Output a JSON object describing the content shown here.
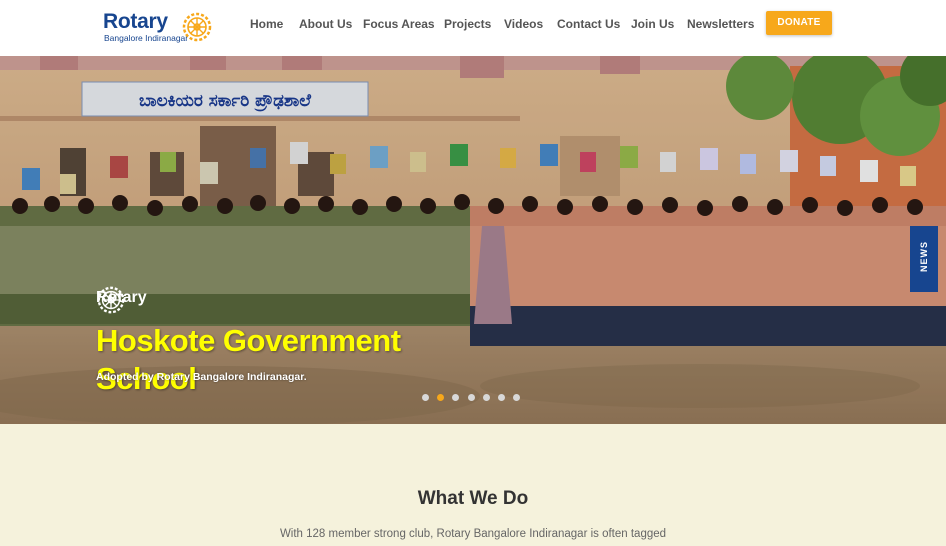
{
  "header": {
    "logo_word": "Rotary",
    "logo_sub": "Bangalore Indiranagar",
    "nav": [
      "Home",
      "About Us",
      "Focus Areas",
      "Projects",
      "Videos",
      "Contact Us",
      "Join Us",
      "Newsletters"
    ],
    "donate_label": "DONATE"
  },
  "hero": {
    "slide_logo_word": "Rotary",
    "title": "Hoskote Government School",
    "caption": "Adopted by Rotary Bangalore Indiranagar.",
    "slide_count": 7,
    "active_slide": 2,
    "news_tab_label": "NEWS",
    "building_sign": "ಬಾಲಕಿಯರ ಸರ್ಕಾರಿ ಪ್ರೌಢಶಾಲೆ"
  },
  "section": {
    "title": "What We Do",
    "text": "With 128 member strong club, Rotary Bangalore Indiranagar is often tagged"
  },
  "colors": {
    "brand_blue": "#17458f",
    "accent_gold": "#f7a81b",
    "title_yellow": "#ffff00",
    "section_bg": "#f5f2dc"
  }
}
